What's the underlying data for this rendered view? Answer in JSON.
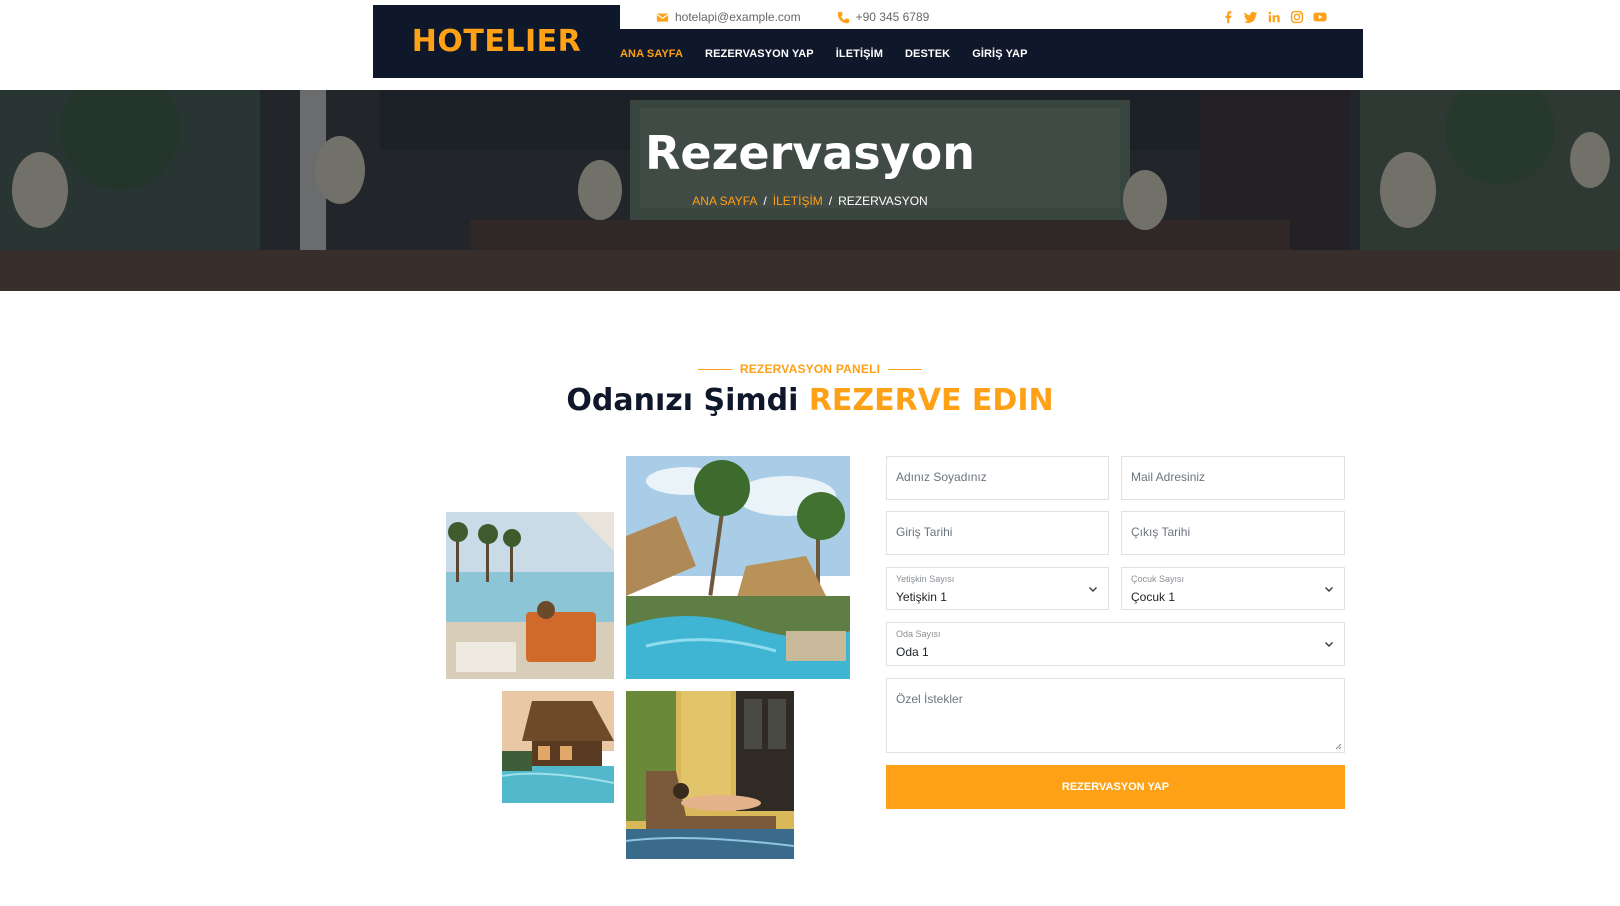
{
  "brand": {
    "name": "HOTELIER"
  },
  "topbar": {
    "email": "hotelapi@example.com",
    "phone": "+90 345 6789",
    "socials": [
      "facebook-icon",
      "twitter-icon",
      "linkedin-icon",
      "instagram-icon",
      "youtube-icon"
    ]
  },
  "nav": {
    "items": [
      {
        "label": "ANA SAYFA",
        "active": true
      },
      {
        "label": "REZERVASYON YAP",
        "active": false
      },
      {
        "label": "İLETİŞİM",
        "active": false
      },
      {
        "label": "DESTEK",
        "active": false
      },
      {
        "label": "GİRİŞ YAP",
        "active": false
      }
    ]
  },
  "hero": {
    "title": "Rezervasyon",
    "breadcrumb": [
      "ANA SAYFA",
      "İLETİŞİM",
      "REZERVASYON"
    ]
  },
  "section": {
    "kicker": "REZERVASYON PANELI",
    "title_plain": "Odanızı Şimdi",
    "title_accent": "REZERVE EDIN"
  },
  "form": {
    "name_placeholder": "Adınız Soyadınız",
    "email_placeholder": "Mail Adresiniz",
    "checkin_placeholder": "Giriş Tarihi",
    "checkout_placeholder": "Çıkış Tarihi",
    "adults": {
      "label": "Yetişkin Sayısı",
      "value": "Yetişkin 1"
    },
    "children": {
      "label": "Çocuk Sayısı",
      "value": "Çocuk 1"
    },
    "rooms": {
      "label": "Oda Sayısı",
      "value": "Oda 1"
    },
    "requests_placeholder": "Özel İstekler",
    "submit_label": "REZERVASYON YAP"
  },
  "colors": {
    "primary": "#fea116",
    "dark": "#0f172b"
  }
}
